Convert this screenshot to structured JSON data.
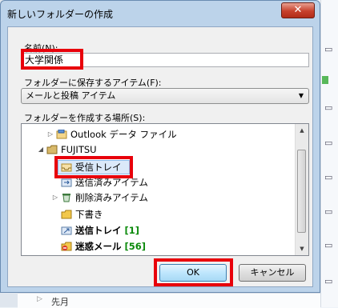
{
  "dialog": {
    "title": "新しいフォルダーの作成",
    "close_label": "✕",
    "name_label": "名前(N):",
    "name_value": "大学関係",
    "type_label": "フォルダーに保存するアイテム(F):",
    "type_value": "メールと投稿 アイテム",
    "location_label": "フォルダーを作成する場所(S):",
    "ok_label": "OK",
    "cancel_label": "キャンセル"
  },
  "tree": {
    "outlook_data": "Outlook データ ファイル",
    "fujitsu": "FUJITSU",
    "inbox": "受信トレイ",
    "sent": "送信済みアイテム",
    "deleted": "削除済みアイテム",
    "drafts": "下書き",
    "outbox": "送信トレイ",
    "outbox_count": "[1]",
    "junk": "迷惑メール",
    "junk_count": "[56]"
  },
  "background": {
    "bottom_item": "先月"
  },
  "colors": {
    "highlight": "#e8000b",
    "count_green": "#0c8a0c"
  }
}
